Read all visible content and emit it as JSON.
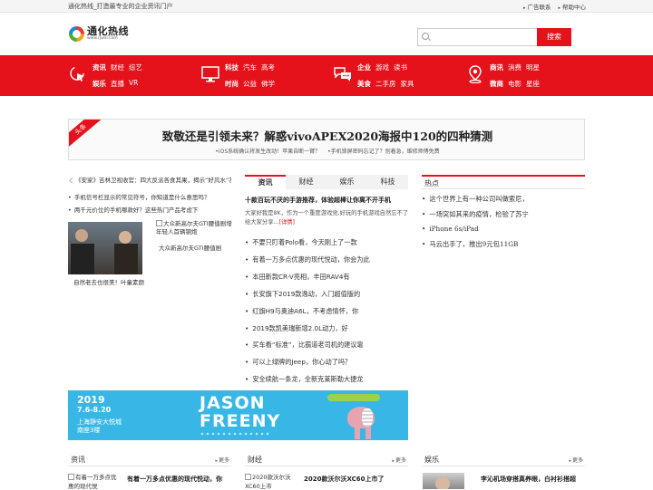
{
  "topbar": {
    "tagline": "通化热线_打造最专业的企业资讯门户",
    "links": [
      "广告联系",
      "帮助中心"
    ]
  },
  "logo": {
    "name": "通化热线",
    "url": "www.rjwxl.com"
  },
  "search": {
    "placeholder": "",
    "button": "搜索"
  },
  "nav": [
    {
      "icon": "cursor-click-icon",
      "row1": [
        "资讯",
        "财经",
        "综艺"
      ],
      "row2": [
        "娱乐",
        "直播",
        "VR"
      ]
    },
    {
      "icon": "monitor-icon",
      "row1": [
        "科技",
        "汽车",
        "高考"
      ],
      "row2": [
        "时尚",
        "公益",
        "佛学"
      ]
    },
    {
      "icon": "chat-bubbles-icon",
      "row1": [
        "企业",
        "游戏",
        "读书"
      ],
      "row2": [
        "美食",
        "二手房",
        "家具"
      ]
    },
    {
      "icon": "map-pin-icon",
      "row1": [
        "商讯",
        "消费",
        "明星"
      ],
      "row2": [
        "微商",
        "电影",
        "星座"
      ]
    }
  ],
  "banner": {
    "ribbon": "头条",
    "headline": "致敬还是引领未来？解惑vivoAPEX2020海报中120的四种猜测",
    "subs": [
      "•iOS系统确认将发生改动！苹果自断一臂？",
      "•手机锁屏密码忘记了？别着急，维修师傅免费"
    ]
  },
  "left": {
    "slider_text": "《安家》吉林卫视收官：四大反派各食其果，揭示“好风水”答案",
    "list": [
      "手机信号栏显示的常见符号，你知道是什么意思吗？",
      "两千元价位的手机哪款好？这些热门产品考虑下"
    ],
    "photo1_caption": "自然老去也很美！叶童素颜",
    "photo2_alt": "大众新高尔夫GTI腰值剧增 年轻人首辆钢炮",
    "photo2_caption": "大众新高尔夫GTI腰值剧"
  },
  "middle": {
    "tabs": [
      "资讯",
      "财经",
      "娱乐",
      "科技"
    ],
    "headline": "十款百玩不厌的手游推荐，体验超棒让你离不开手机",
    "summary": "大家好我是8K，作为一个重度游戏党,好玩的手机游戏自然忘不了给大家分享...",
    "summary_more": "[详情]",
    "list": [
      "不要只盯着Polo看，今天刚上了一款",
      "有着一万多点优惠的现代悦动，你会为此",
      "本田新款CR-V亮相，丰田RAV4有",
      "长安旗下2019款逸动，入门超值版的",
      "红旗H9与奥迪A6L，不考虑情怀，你",
      "2019款凯美瑞新增2.0L动力，好",
      "买车看“标准”，比霸道老司机的建议靠",
      "可以上绿牌的Jeep，你心动了吗？",
      "安全续航一条龙，全新克莱斯勒大捷龙"
    ]
  },
  "right": {
    "title": "热点",
    "list": [
      "这个世界上有一种公司叫做索尼，",
      "一场突如其来的疫情，检验了苏宁",
      "iPhone 6s/iPad",
      "马云出手了，推出9元包11GB"
    ]
  },
  "ad": {
    "year": "2019",
    "dates": "7.6-8.20",
    "location1": "上海静安大悦城",
    "location2": "南座3楼",
    "title1": "JASON",
    "title2": "FREENY"
  },
  "sections": [
    {
      "title": "资讯",
      "more": "更多",
      "thumb_alt": "有着一万多点优惠的现代悦",
      "headline": "有着一万多点优惠的现代悦动，你"
    },
    {
      "title": "财经",
      "more": "更多",
      "thumb_alt": "2020款沃尔沃XC60上市",
      "headline": "2020款沃尔沃XC60上市了"
    },
    {
      "title": "娱乐",
      "more": "更多",
      "headline": "李沁机场穿搭真养眼，白衬衫搭超"
    }
  ]
}
